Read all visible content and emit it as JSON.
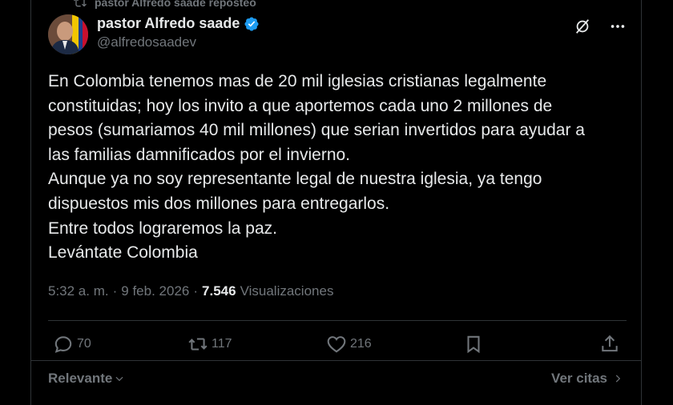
{
  "repost": {
    "text": "pastor Alfredo saade reposteó",
    "icon": "repost-icon"
  },
  "author": {
    "name": "pastor Alfredo saade",
    "handle": "@alfredosaadev",
    "verified_icon": "verified-badge-icon",
    "verified_color": "#1d9bf0"
  },
  "tweet": {
    "lines": [
      "En Colombia tenemos mas de 20 mil iglesias cristianas legalmente",
      "constituidas; hoy los invito a que aportemos cada uno 2 millones de",
      "pesos (sumariamos 40 mil millones) que serian invertidos para ayudar a",
      "las familias damnificados por el invierno.",
      "Aunque ya no soy representante legal de nuestra iglesia, ya tengo",
      "dispuestos mis dos millones para entregarlos.",
      "Entre todos lograremos la paz.",
      "Levántate Colombia"
    ]
  },
  "meta": {
    "time": "5:32 a. m.",
    "sep1": "·",
    "date": "9 feb. 2026",
    "sep2": "·",
    "views_count": "7.546",
    "views_label": "Visualizaciones"
  },
  "actions": {
    "replies": "70",
    "reposts": "117",
    "likes": "216"
  },
  "footer": {
    "sort_label": "Relevante",
    "quotes_label": "Ver citas"
  },
  "colors": {
    "background": "#000000",
    "text": "#e7e9ea",
    "muted": "#71767b",
    "border": "#2f3336",
    "accent": "#1d9bf0"
  }
}
